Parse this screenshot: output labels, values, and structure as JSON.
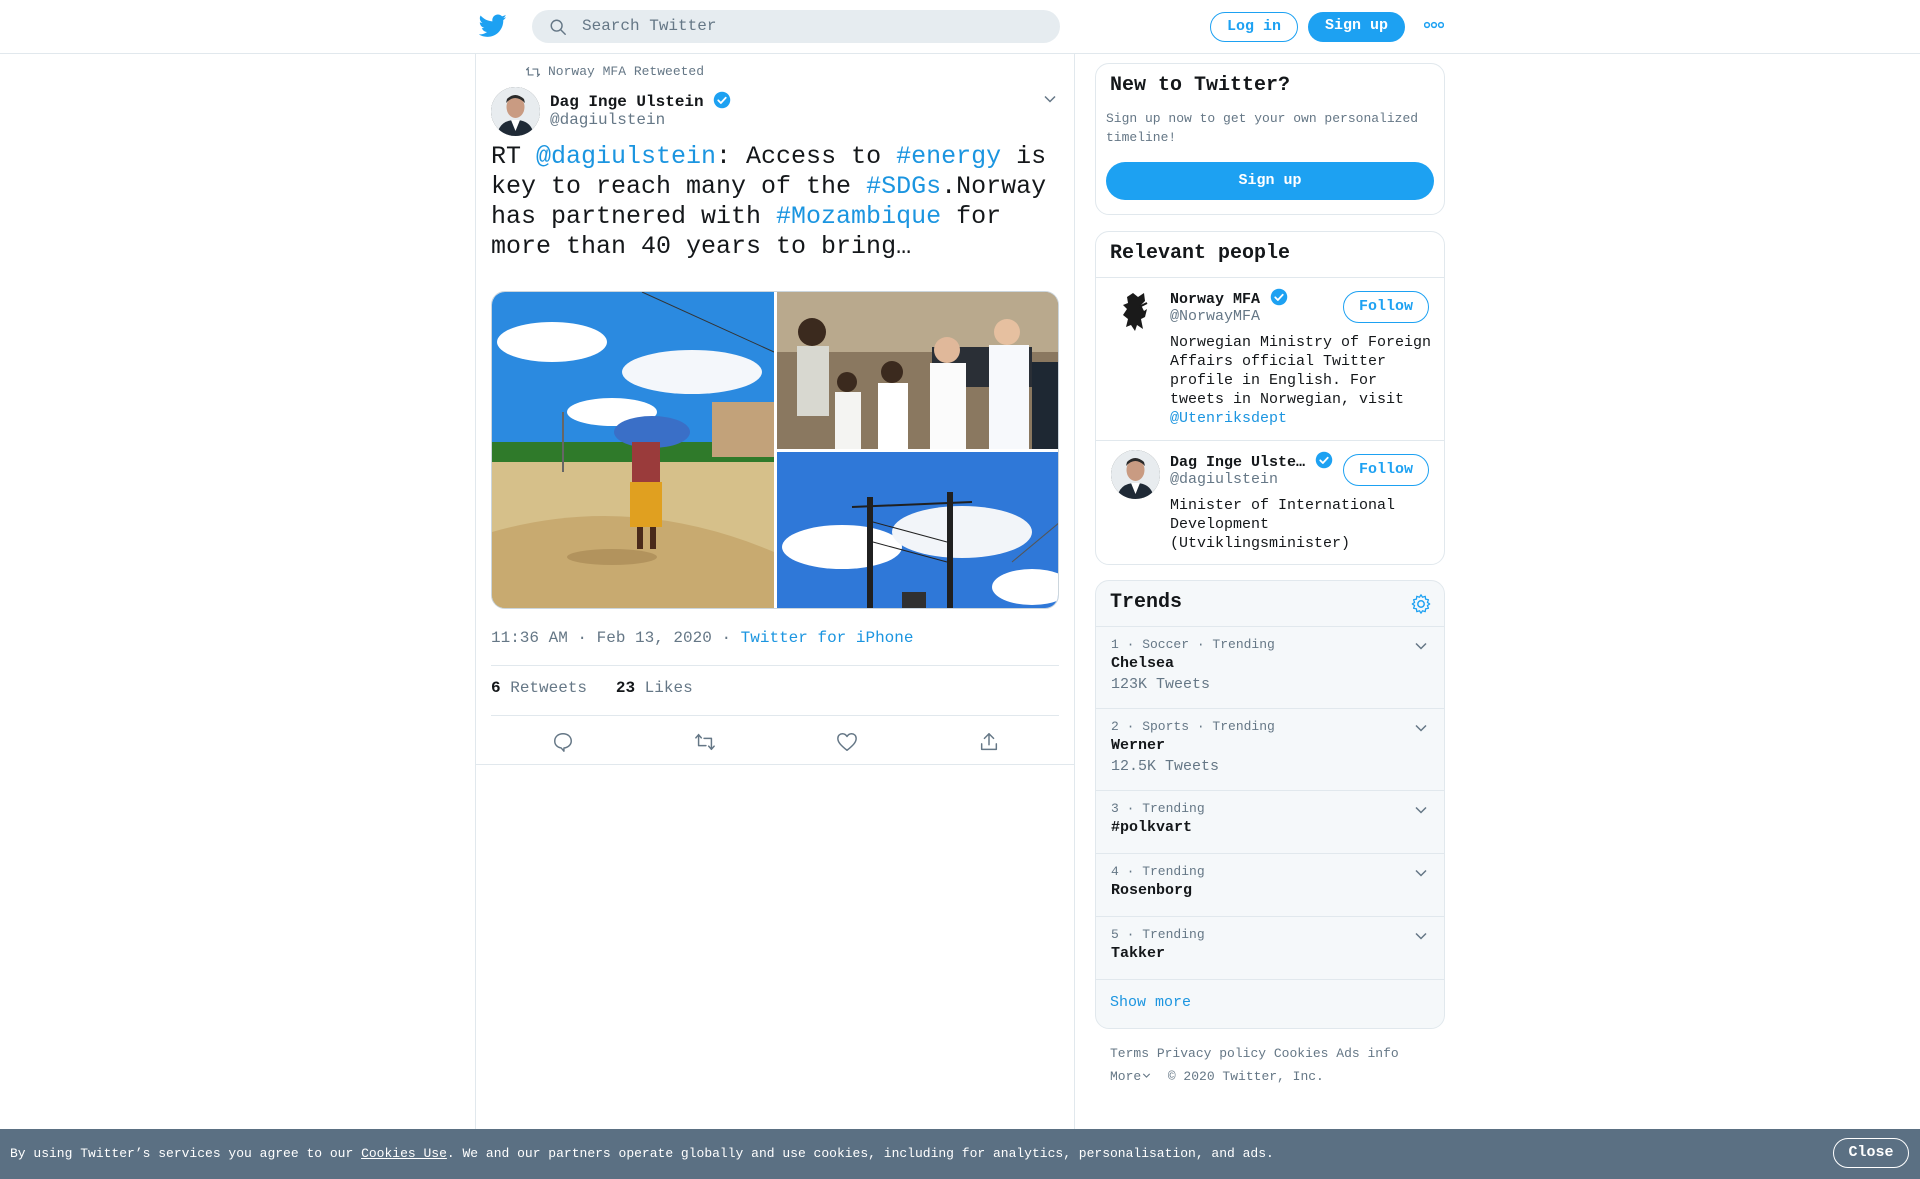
{
  "header": {
    "search_placeholder": "Search Twitter",
    "login_label": "Log in",
    "signup_label": "Sign up"
  },
  "tweet": {
    "retweeted_by": "Norway MFA Retweeted",
    "author_name": "Dag Inge Ulstein",
    "author_handle": "@dagiulstein",
    "text_parts": {
      "p1": "RT ",
      "mention": "@dagiulstein",
      "p2": ": Access to ",
      "tag1": "#energy",
      "p3": " is key to reach many of the ",
      "tag2": "#SDGs",
      "p4": ".Norway has partnered with ",
      "tag3": "#Mozambique",
      "p5": " for more than 40 years to bring…"
    },
    "timestamp": "11:36 AM · Feb 13, 2020",
    "sep": " · ",
    "source": "Twitter for iPhone",
    "retweets_count": "6",
    "retweets_label": "Retweets",
    "likes_count": "23",
    "likes_label": "Likes"
  },
  "new_to_twitter": {
    "title": "New to Twitter?",
    "description": "Sign up now to get your own personalized timeline!",
    "button": "Sign up"
  },
  "relevant_people": {
    "title": "Relevant people",
    "follow_label": "Follow",
    "people": [
      {
        "name": "Norway MFA",
        "handle": "@NorwayMFA",
        "bio": "Norwegian Ministry of Foreign Affairs official Twitter profile in English. For tweets in Norwegian, visit ",
        "bio_link": "@Utenriksdept"
      },
      {
        "name": "Dag Inge Ulste…",
        "handle": "@dagiulstein",
        "bio": "Minister of International Development (Utviklingsminister)"
      }
    ]
  },
  "trends": {
    "title": "Trends",
    "items": [
      {
        "context": "1 · Soccer · Trending",
        "name": "Chelsea",
        "count": "123K Tweets"
      },
      {
        "context": "2 · Sports · Trending",
        "name": "Werner",
        "count": "12.5K Tweets"
      },
      {
        "context": "3 · Trending",
        "name": "#polkvart",
        "count": ""
      },
      {
        "context": "4 · Trending",
        "name": "Rosenborg",
        "count": ""
      },
      {
        "context": "5 · Trending",
        "name": "Takker",
        "count": ""
      }
    ],
    "show_more": "Show more"
  },
  "footer": {
    "terms": "Terms",
    "privacy": "Privacy policy",
    "cookies": "Cookies",
    "ads": "Ads info",
    "more": "More",
    "copyright": "© 2020 Twitter, Inc."
  },
  "cookie_bar": {
    "text_before": "By using Twitter’s services you agree to our ",
    "link": "Cookies Use",
    "text_after": ". We and our partners operate globally and use cookies, including for analytics, personalisation, and ads.",
    "close": "Close"
  },
  "colors": {
    "brand": "#1da1f2",
    "link": "#1b95e0",
    "secondary_text": "#657786",
    "cookie_bar": "#5b7083"
  }
}
